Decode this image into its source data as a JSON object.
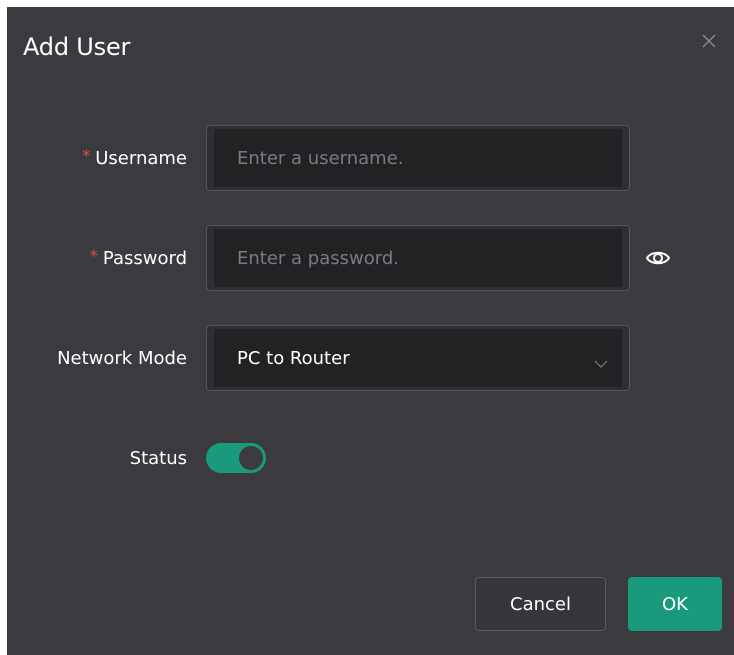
{
  "dialog": {
    "title": "Add User",
    "close_icon": "close-icon"
  },
  "form": {
    "username": {
      "label": "Username",
      "required_mark": "*",
      "placeholder": "Enter a username.",
      "value": ""
    },
    "password": {
      "label": "Password",
      "required_mark": "*",
      "placeholder": "Enter a password.",
      "value": "",
      "visibility_icon": "eye-icon"
    },
    "network_mode": {
      "label": "Network Mode",
      "selected": "PC to Router",
      "dropdown_icon": "chevron-down-icon"
    },
    "status": {
      "label": "Status",
      "enabled": true
    }
  },
  "footer": {
    "cancel_label": "Cancel",
    "ok_label": "OK"
  },
  "colors": {
    "dialog_bg": "#3b3b3f",
    "input_bg": "#222225",
    "accent": "#199b7b",
    "required": "#e24b4b"
  }
}
